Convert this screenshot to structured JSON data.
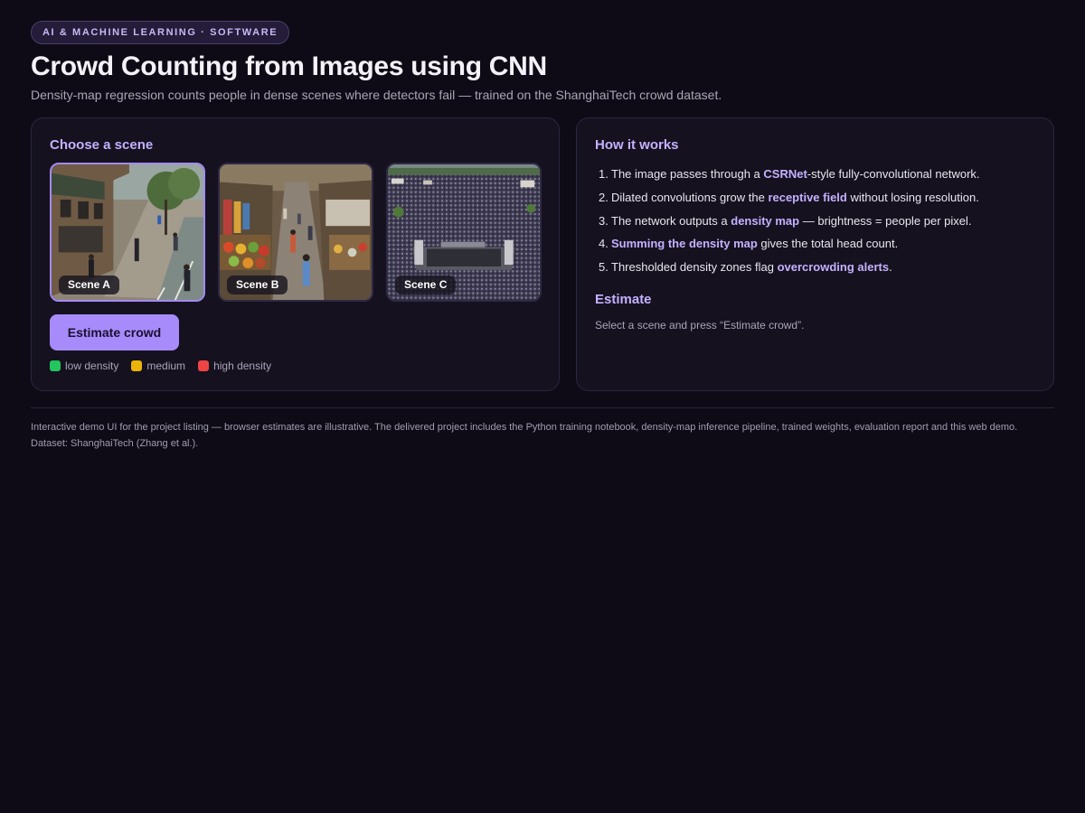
{
  "header": {
    "badge": "AI & MACHINE LEARNING · SOFTWARE",
    "title": "Crowd Counting from Images using CNN",
    "subtitle": "Density-map regression counts people in dense scenes where detectors fail — trained on the ShanghaiTech crowd dataset."
  },
  "scene_panel": {
    "heading": "Choose a scene",
    "scenes": [
      {
        "label": "Scene A",
        "selected": true
      },
      {
        "label": "Scene B",
        "selected": false
      },
      {
        "label": "Scene C",
        "selected": false
      }
    ],
    "button_label": "Estimate crowd",
    "legend": [
      {
        "label": "low density",
        "color": "#22c55e"
      },
      {
        "label": "medium",
        "color": "#eab308"
      },
      {
        "label": "high density",
        "color": "#ef4444"
      }
    ]
  },
  "info_panel": {
    "heading": "How it works",
    "steps": [
      {
        "num": "1.",
        "before": "The image passes through a ",
        "strong": "CSRNet",
        "after": "-style fully-convolutional network."
      },
      {
        "num": "2.",
        "before": "Dilated convolutions grow the ",
        "strong": "receptive field",
        "after": " without losing resolution."
      },
      {
        "num": "3.",
        "before": "The network outputs a ",
        "strong": "density map",
        "after": " — brightness = people per pixel."
      },
      {
        "num": "4.",
        "before": "",
        "strong": "Summing the density map",
        "after": " gives the total head count."
      },
      {
        "num": "5.",
        "before": "Thresholded density zones flag ",
        "strong": "overcrowding alerts",
        "after": "."
      }
    ],
    "estimate_heading": "Estimate",
    "estimate_text": "Select a scene and press “Estimate crowd”."
  },
  "footer": {
    "text": "Interactive demo UI for the project listing — browser estimates are illustrative. The delivered project includes the Python training notebook, density-map inference pipeline, trained weights, evaluation report and this web demo. Dataset: ShanghaiTech (Zhang et al.)."
  },
  "colors": {
    "background": "#0e0b16",
    "accent": "#a78bfa",
    "accent_text": "#c4b1ff",
    "panel": "#15111f"
  }
}
